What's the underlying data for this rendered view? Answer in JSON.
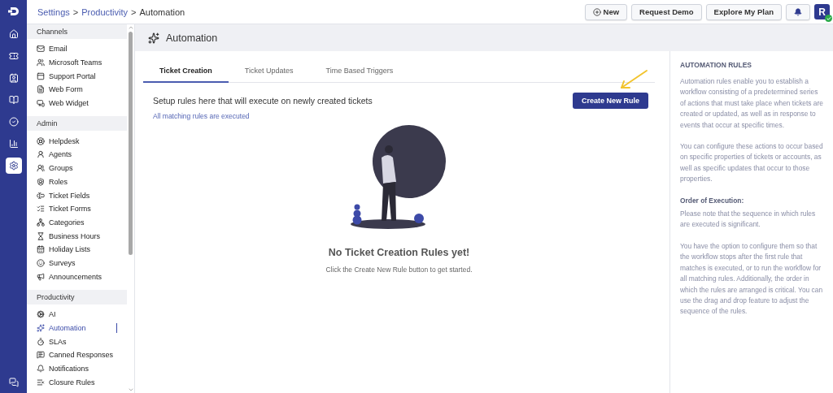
{
  "rail": {
    "items": [
      {
        "selected": false
      },
      {
        "selected": false
      },
      {
        "selected": false
      },
      {
        "selected": false
      },
      {
        "selected": false
      },
      {
        "selected": false
      },
      {
        "selected": true
      }
    ]
  },
  "breadcrumb": {
    "separator": ">",
    "items": [
      {
        "label": "Settings",
        "link": true
      },
      {
        "label": "Productivity",
        "link": true
      },
      {
        "label": "Automation",
        "link": false
      }
    ]
  },
  "top_actions": {
    "new": "New",
    "buttons": [
      "Request Demo",
      "Explore My Plan"
    ],
    "avatar": "R"
  },
  "sidebar": {
    "sections": [
      {
        "title": "Channels",
        "items": [
          {
            "label": "Email",
            "selected": false
          },
          {
            "label": "Microsoft Teams",
            "selected": false
          },
          {
            "label": "Support Portal",
            "selected": false
          },
          {
            "label": "Web Form",
            "selected": false
          },
          {
            "label": "Web Widget",
            "selected": false
          }
        ]
      },
      {
        "title": "Admin",
        "items": [
          {
            "label": "Helpdesk",
            "selected": false
          },
          {
            "label": "Agents",
            "selected": false
          },
          {
            "label": "Groups",
            "selected": false
          },
          {
            "label": "Roles",
            "selected": false
          },
          {
            "label": "Ticket Fields",
            "selected": false
          },
          {
            "label": "Ticket Forms",
            "selected": false
          },
          {
            "label": "Categories",
            "selected": false
          },
          {
            "label": "Business Hours",
            "selected": false
          },
          {
            "label": "Holiday Lists",
            "selected": false
          },
          {
            "label": "Surveys",
            "selected": false
          },
          {
            "label": "Announcements",
            "selected": false
          }
        ]
      },
      {
        "title": "Productivity",
        "items": [
          {
            "label": "AI",
            "selected": false
          },
          {
            "label": "Automation",
            "selected": true
          },
          {
            "label": "SLAs",
            "selected": false
          },
          {
            "label": "Canned Responses",
            "selected": false
          },
          {
            "label": "Notifications",
            "selected": false
          },
          {
            "label": "Closure Rules",
            "selected": false
          }
        ]
      }
    ]
  },
  "page": {
    "title": "Automation"
  },
  "tabs": [
    {
      "label": "Ticket Creation",
      "selected": true
    },
    {
      "label": "Ticket Updates",
      "selected": false
    },
    {
      "label": "Time Based Triggers",
      "selected": false
    }
  ],
  "intro": {
    "text": "Setup rules here that will execute on newly created tickets",
    "note": "All matching rules are executed",
    "button": "Create New Rule"
  },
  "empty_state": {
    "title": "No Ticket Creation Rules yet!",
    "hint": "Click the Create New Rule button to get started."
  },
  "help": {
    "title": "AUTOMATION RULES",
    "blocks": [
      {
        "kind": "paragraph",
        "text": "Automation rules enable you to establish a workflow consisting of a predetermined series of actions that must take place when tickets are created or updated, as well as in response to events that occur at specific times."
      },
      {
        "kind": "paragraph",
        "text": "You can configure these actions to occur based on specific properties of tickets or accounts, as well as specific updates that occur to those properties."
      },
      {
        "kind": "heading",
        "text": "Order of Execution:"
      },
      {
        "kind": "note",
        "text": "Please note that the sequence in which rules are executed is significant."
      },
      {
        "kind": "paragraph",
        "text": "You have the option to configure them so that the workflow stops after the first rule that matches is executed, or to run the workflow for all matching rules. Additionally, the order in which the rules are arranged is critical. You can use the drag and drop feature to adjust the sequence of the rules."
      }
    ]
  }
}
